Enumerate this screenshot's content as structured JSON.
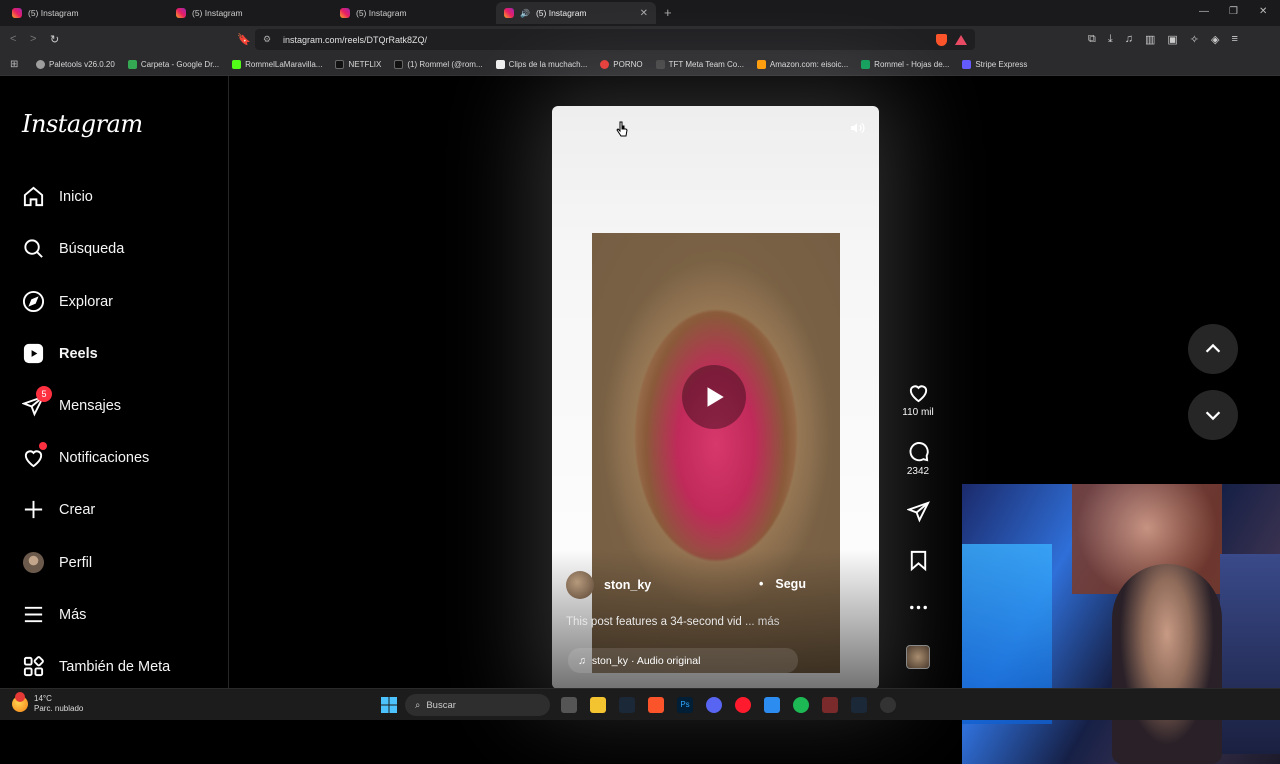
{
  "browser": {
    "tabs": [
      {
        "title": "(5) Instagram",
        "active": false
      },
      {
        "title": "(5) Instagram",
        "active": false
      },
      {
        "title": "(5) Instagram",
        "active": false
      },
      {
        "title": "(5) Instagram",
        "active": true
      }
    ],
    "url": "instagram.com/reels/DTQrRatk8ZQ/",
    "bookmarks": [
      {
        "label": "Paletools v26.0.20",
        "color": "#9e9e9e"
      },
      {
        "label": "Carpeta - Google Dr...",
        "color": "#34a853"
      },
      {
        "label": "RommelLaMaravilla...",
        "color": "#53fc18"
      },
      {
        "label": "NETFLIX",
        "color": "#000000"
      },
      {
        "label": "(1) Rommel (@rom...",
        "color": "#000000"
      },
      {
        "label": "Clips de la muchach...",
        "color": "#ffffff"
      },
      {
        "label": "PORNO",
        "color": "#e53935"
      },
      {
        "label": "TFT Meta Team Co...",
        "color": "#444444"
      },
      {
        "label": "Amazon.com: eisoic...",
        "color": "#ff9900"
      },
      {
        "label": "Rommel - Hojas de...",
        "color": "#0f9d58"
      },
      {
        "label": "Stripe Express",
        "color": "#635bff"
      }
    ]
  },
  "sidebar": {
    "logo": "Instagram",
    "items": [
      {
        "label": "Inicio",
        "icon": "home-icon"
      },
      {
        "label": "Búsqueda",
        "icon": "search-icon"
      },
      {
        "label": "Explorar",
        "icon": "compass-icon"
      },
      {
        "label": "Reels",
        "icon": "reels-icon",
        "active": true
      },
      {
        "label": "Mensajes",
        "icon": "messenger-icon",
        "badge": "5"
      },
      {
        "label": "Notificaciones",
        "icon": "heart-icon"
      },
      {
        "label": "Crear",
        "icon": "plus-icon"
      },
      {
        "label": "Perfil",
        "icon": "avatar-icon"
      },
      {
        "label": "Más",
        "icon": "menu-icon"
      },
      {
        "label": "También de Meta",
        "icon": "meta-grid-icon"
      }
    ]
  },
  "reel": {
    "username": "ston_ky",
    "follow_label": "Segu",
    "caption": "This post features a 34-second vid",
    "more_label": "... más",
    "audio": "ston_ky · Audio original",
    "likes": "110 mil",
    "comments": "2342"
  },
  "taskbar": {
    "temperature": "14°C",
    "weather": "Parc. nublado",
    "search_label": "Buscar"
  }
}
